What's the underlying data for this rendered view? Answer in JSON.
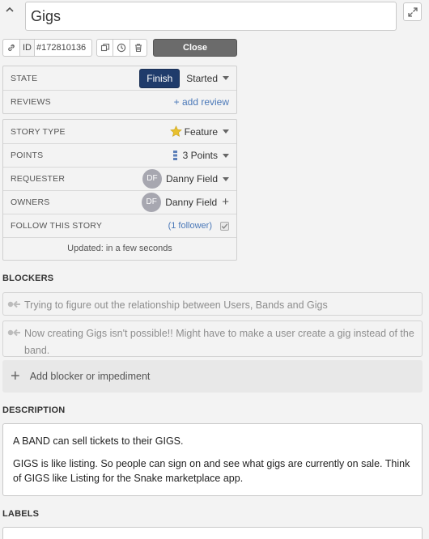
{
  "title": "Gigs",
  "toolbar": {
    "id_label": "ID",
    "id_value": "#172810136",
    "close_label": "Close"
  },
  "state": {
    "label": "STATE",
    "finish_label": "Finish",
    "current": "Started"
  },
  "reviews": {
    "label": "REVIEWS",
    "add_label": "+ add review"
  },
  "story_type": {
    "label": "STORY TYPE",
    "value": "Feature"
  },
  "points": {
    "label": "POINTS",
    "value": "3 Points"
  },
  "requester": {
    "label": "REQUESTER",
    "initials": "DF",
    "name": "Danny Field"
  },
  "owners": {
    "label": "OWNERS",
    "initials": "DF",
    "name": "Danny Field"
  },
  "follow": {
    "label": "FOLLOW THIS STORY",
    "followers": "(1 follower)"
  },
  "updated": "Updated: in a few seconds",
  "blockers": {
    "title": "BLOCKERS",
    "items": [
      "Trying to figure out the relationship between Users, Bands and Gigs",
      "Now creating Gigs isn't possible!! Might have to make a user create a gig instead of the band."
    ],
    "add_label": "Add blocker or impediment"
  },
  "description": {
    "title": "DESCRIPTION",
    "paragraphs": [
      "A BAND can sell tickets to their GIGS.",
      "GIGS is like listing. So people can sign on and see what gigs are currently on sale. Think of GIGS like Listing for the Snake marketplace app."
    ]
  },
  "labels": {
    "title": "LABELS"
  },
  "colors": {
    "finish_button": "#1f3b6b",
    "close_button": "#6b6b6b",
    "link": "#4a78b8",
    "feature_star": "#e8c02f",
    "points_icon": "#5c7fb8",
    "avatar": "#a7a7b0"
  },
  "icons": {
    "collapse": "chevron-up-icon",
    "expand": "expand-icon",
    "link": "link-icon",
    "copy": "copy-icon",
    "history": "clock-icon",
    "delete": "trash-icon",
    "story_type": "star-icon",
    "points": "points-bars-icon",
    "blocker": "blocker-arrow-icon",
    "add": "plus-icon",
    "follow": "checkbox-icon"
  }
}
